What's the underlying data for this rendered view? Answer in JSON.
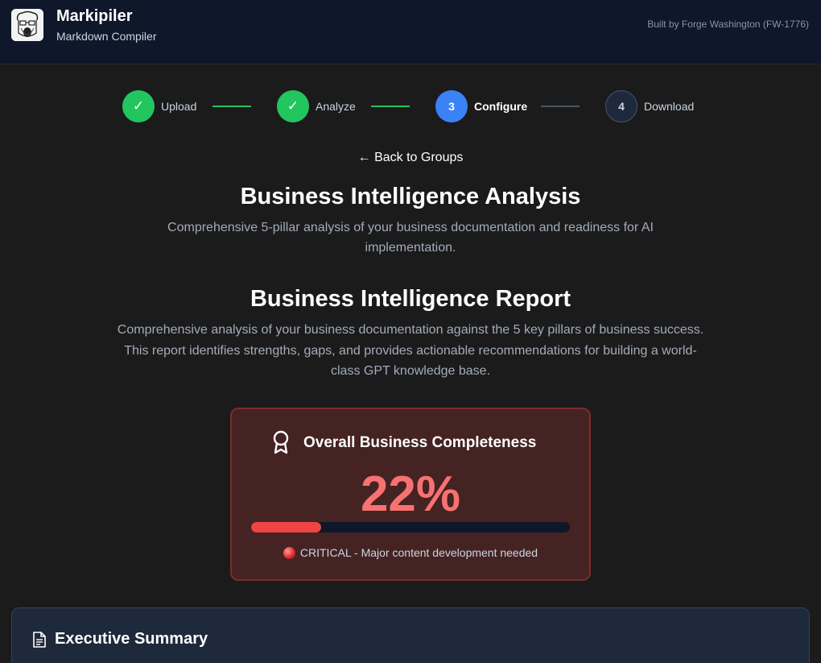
{
  "header": {
    "app_name": "Markipiler",
    "app_subtitle": "Markdown Compiler",
    "built_by": "Built by Forge Washington (FW-1776)"
  },
  "stepper": {
    "steps": [
      {
        "number": "✓",
        "label": "Upload",
        "state": "done"
      },
      {
        "number": "✓",
        "label": "Analyze",
        "state": "done"
      },
      {
        "number": "3",
        "label": "Configure",
        "state": "active"
      },
      {
        "number": "4",
        "label": "Download",
        "state": "pending"
      }
    ]
  },
  "nav": {
    "back_label": "← Back to Groups"
  },
  "analysis": {
    "title": "Business Intelligence Analysis",
    "description": "Comprehensive 5-pillar analysis of your business documentation and readiness for AI implementation."
  },
  "report": {
    "title": "Business Intelligence Report",
    "description": "Comprehensive analysis of your business documentation against the 5 key pillars of business success. This report identifies strengths, gaps, and provides actionable recommendations for building a world-class GPT knowledge base."
  },
  "score_card": {
    "icon": "award-icon",
    "title": "Overall Business Completeness",
    "score_text": "22%",
    "score_fraction": 0.22,
    "status_text": "CRITICAL - Major content development needed",
    "status_color": "#ef4444"
  },
  "summary": {
    "icon": "document-icon",
    "title": "Executive Summary"
  },
  "colors": {
    "done": "#22c55e",
    "active": "#3b82f6",
    "critical": "#f87171"
  }
}
